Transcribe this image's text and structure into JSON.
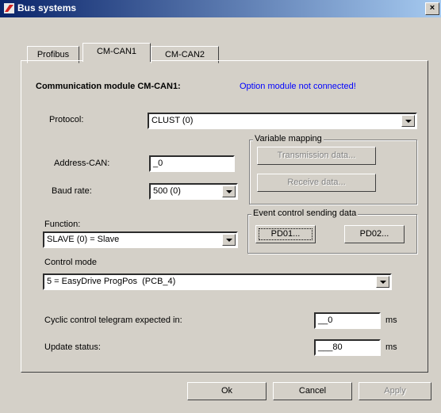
{
  "window": {
    "title": "Bus systems",
    "close_label": "×"
  },
  "tabs": [
    {
      "label": "Profibus"
    },
    {
      "label": "CM-CAN1"
    },
    {
      "label": "CM-CAN2"
    }
  ],
  "module": {
    "heading": "Communication module CM-CAN1:",
    "status": "Option module not connected!",
    "status_color": "#0000ff"
  },
  "protocol": {
    "label": "Protocol:",
    "value": "CLUST (0)"
  },
  "address": {
    "label": "Address-CAN:",
    "value": "_0"
  },
  "baud": {
    "label": "Baud rate:",
    "value": "500 (0)"
  },
  "function": {
    "label": "Function:",
    "value": "SLAVE (0) = Slave"
  },
  "variable_mapping": {
    "title": "Variable mapping",
    "transmission": "Transmission data...",
    "receive": "Receive data..."
  },
  "event_control": {
    "title": "Event control sending data",
    "pd01": "PD01...",
    "pd02": "PD02..."
  },
  "control_mode": {
    "label": "Control mode",
    "value": "5 = EasyDrive ProgPos  (PCB_4)"
  },
  "cyclic": {
    "label": "Cyclic control telegram expected in:",
    "value": "__0",
    "unit": "ms"
  },
  "update": {
    "label": "Update status:",
    "value": "___80",
    "unit": "ms"
  },
  "footer": {
    "ok": "Ok",
    "cancel": "Cancel",
    "apply": "Apply"
  }
}
